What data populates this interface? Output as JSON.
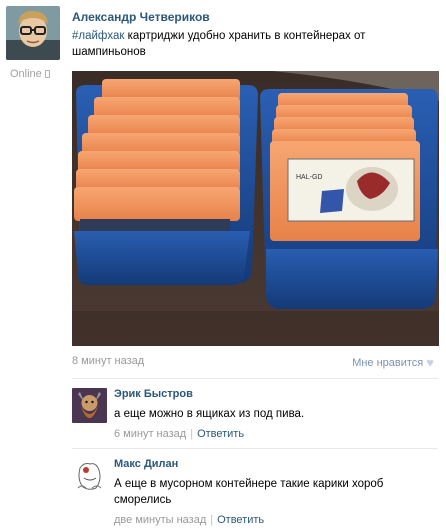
{
  "post": {
    "author": "Александр Четвериков",
    "online_status": "Online",
    "hashtag": "#лайфхак",
    "text": " картриджи удобно хранить в контейнерах от шампиньонов",
    "timestamp": "8 минут назад",
    "like_label": "Мне нравится"
  },
  "comments": [
    {
      "author": "Эрик Быстров",
      "text": "а еще можно в ящиках из под пива.",
      "timestamp": "6 минут назад",
      "reply_label": "Ответить"
    },
    {
      "author": "Макс Дилан",
      "text": "А еще в мусорном контейнере такие карики хороб сморелись",
      "timestamp": "две минуты назад",
      "reply_label": "Ответить"
    }
  ],
  "colors": {
    "link": "#2b587a",
    "meta": "#999999",
    "divider": "#e7eaed",
    "container": "#1e56a8",
    "cartridge": "#f0905a"
  },
  "icons": [
    "phone-icon",
    "apple-icon",
    "heart-icon"
  ]
}
